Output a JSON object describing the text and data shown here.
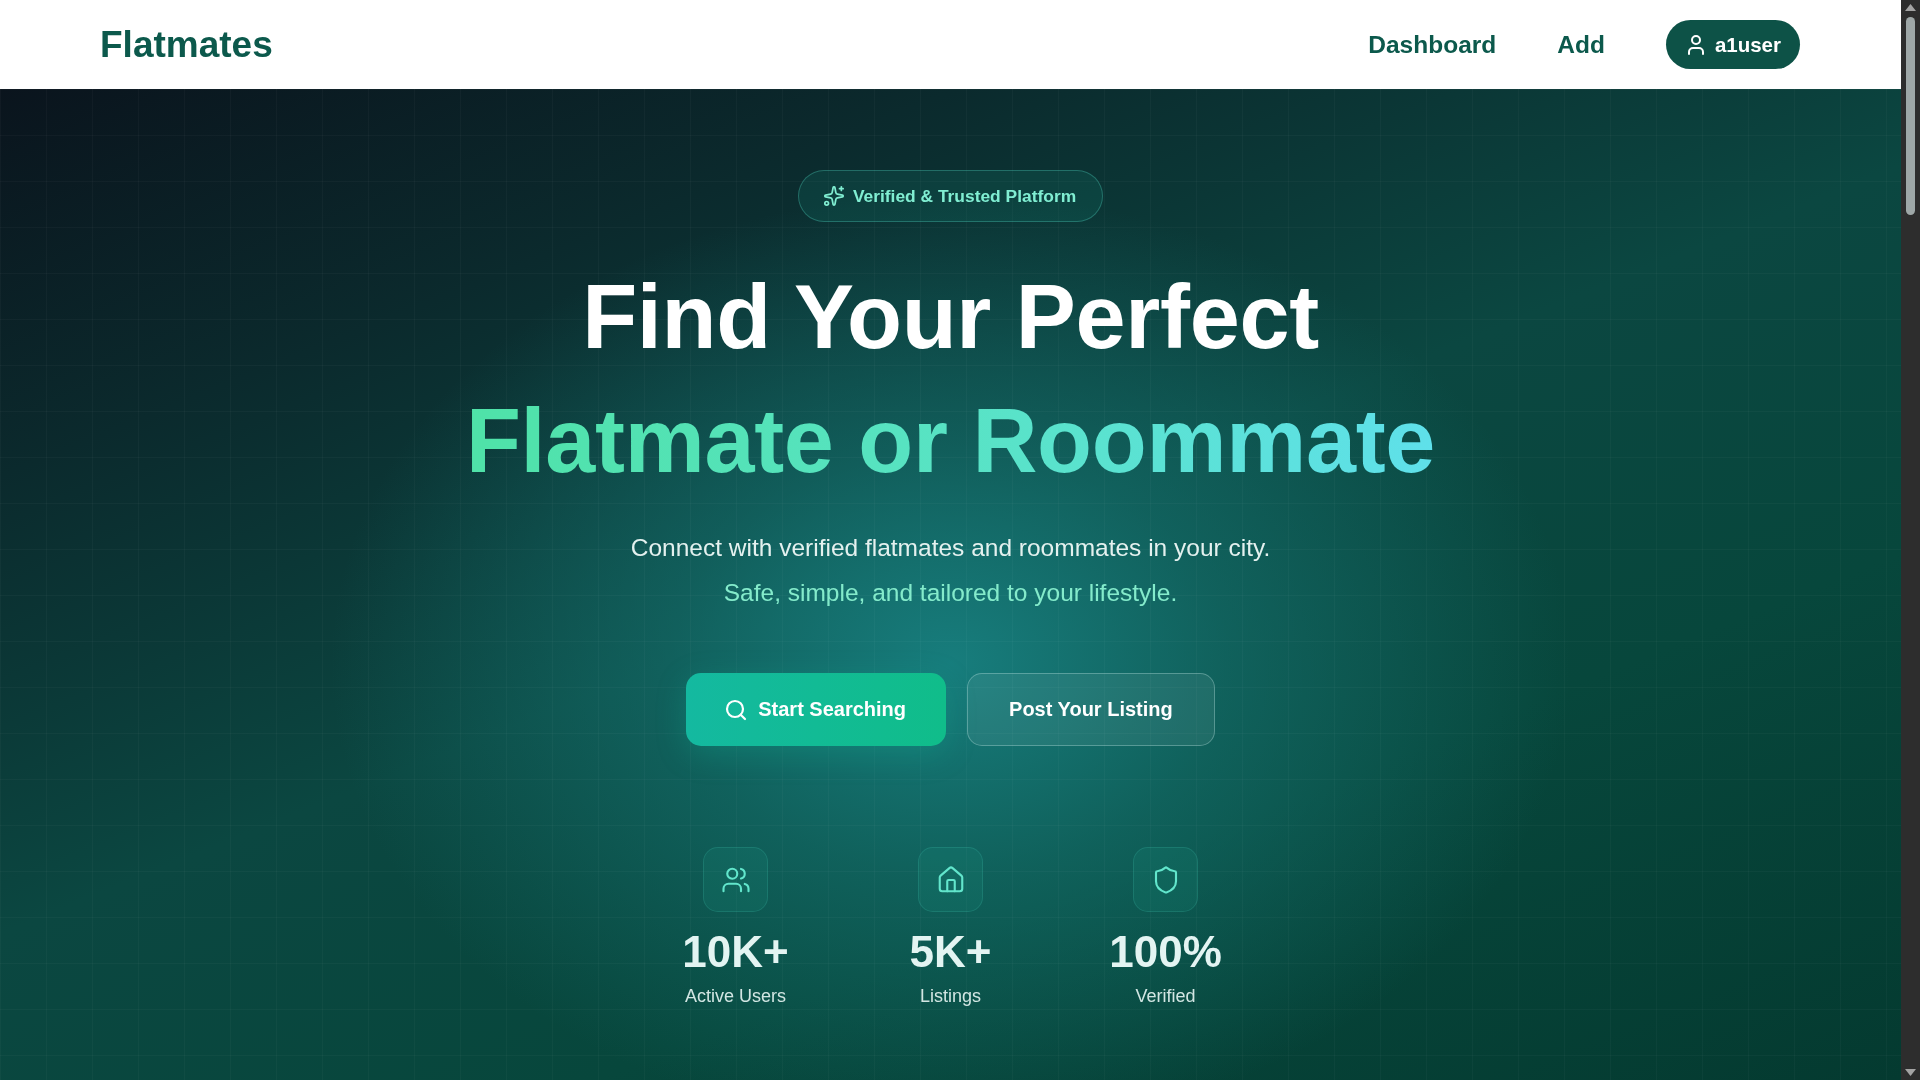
{
  "header": {
    "logo": "Flatmates",
    "nav": [
      {
        "label": "Dashboard"
      },
      {
        "label": "Add"
      }
    ],
    "user_button": {
      "label": "a1user"
    }
  },
  "hero": {
    "badge": "Verified & Trusted Platform",
    "title_line_1": "Find Your Perfect",
    "title_line_2": "Flatmate or Roommate",
    "subtitle": "Connect with verified flatmates and roommates in your city.",
    "tagline": "Safe, simple, and tailored to your lifestyle.",
    "buttons": [
      {
        "label": "Start Searching",
        "kind": "primary"
      },
      {
        "label": "Post Your Listing",
        "kind": "outline"
      }
    ],
    "stats": [
      {
        "kind": "users",
        "value": "10K+",
        "label": "Active Users"
      },
      {
        "kind": "home",
        "value": "5K+",
        "label": "Listings"
      },
      {
        "kind": "shield",
        "value": "100%",
        "label": "Verified"
      }
    ]
  }
}
